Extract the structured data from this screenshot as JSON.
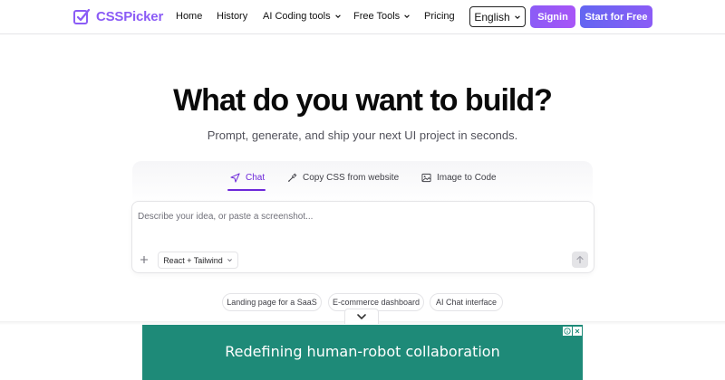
{
  "header": {
    "logo_text": "CSSPicker",
    "nav": [
      {
        "label": "Home",
        "dropdown": false
      },
      {
        "label": "History",
        "dropdown": false
      },
      {
        "label": "AI Coding tools",
        "dropdown": true
      },
      {
        "label": "Free Tools",
        "dropdown": true
      },
      {
        "label": "Pricing",
        "dropdown": false
      }
    ],
    "language": "English",
    "signin_label": "Signin",
    "start_label": "Start for Free"
  },
  "hero": {
    "title": "What do you want to build?",
    "subtitle": "Prompt, generate, and ship your next UI project in seconds."
  },
  "tabs": [
    {
      "label": "Chat",
      "icon": "send-icon",
      "active": true
    },
    {
      "label": "Copy CSS from website",
      "icon": "eyedropper-icon",
      "active": false
    },
    {
      "label": "Image to Code",
      "icon": "image-icon",
      "active": false
    }
  ],
  "prompt": {
    "placeholder": "Describe your idea, or paste a screenshot...",
    "value": "",
    "framework": "React + Tailwind"
  },
  "suggestions": [
    "Landing page for a SaaS",
    "E-commerce dashboard",
    "AI Chat interface"
  ],
  "ad": {
    "text": "Redefining human-robot collaboration"
  },
  "colors": {
    "brand": "#8b5cf6",
    "active_tab": "#6d28d9",
    "ad_background": "#1e8a78"
  }
}
